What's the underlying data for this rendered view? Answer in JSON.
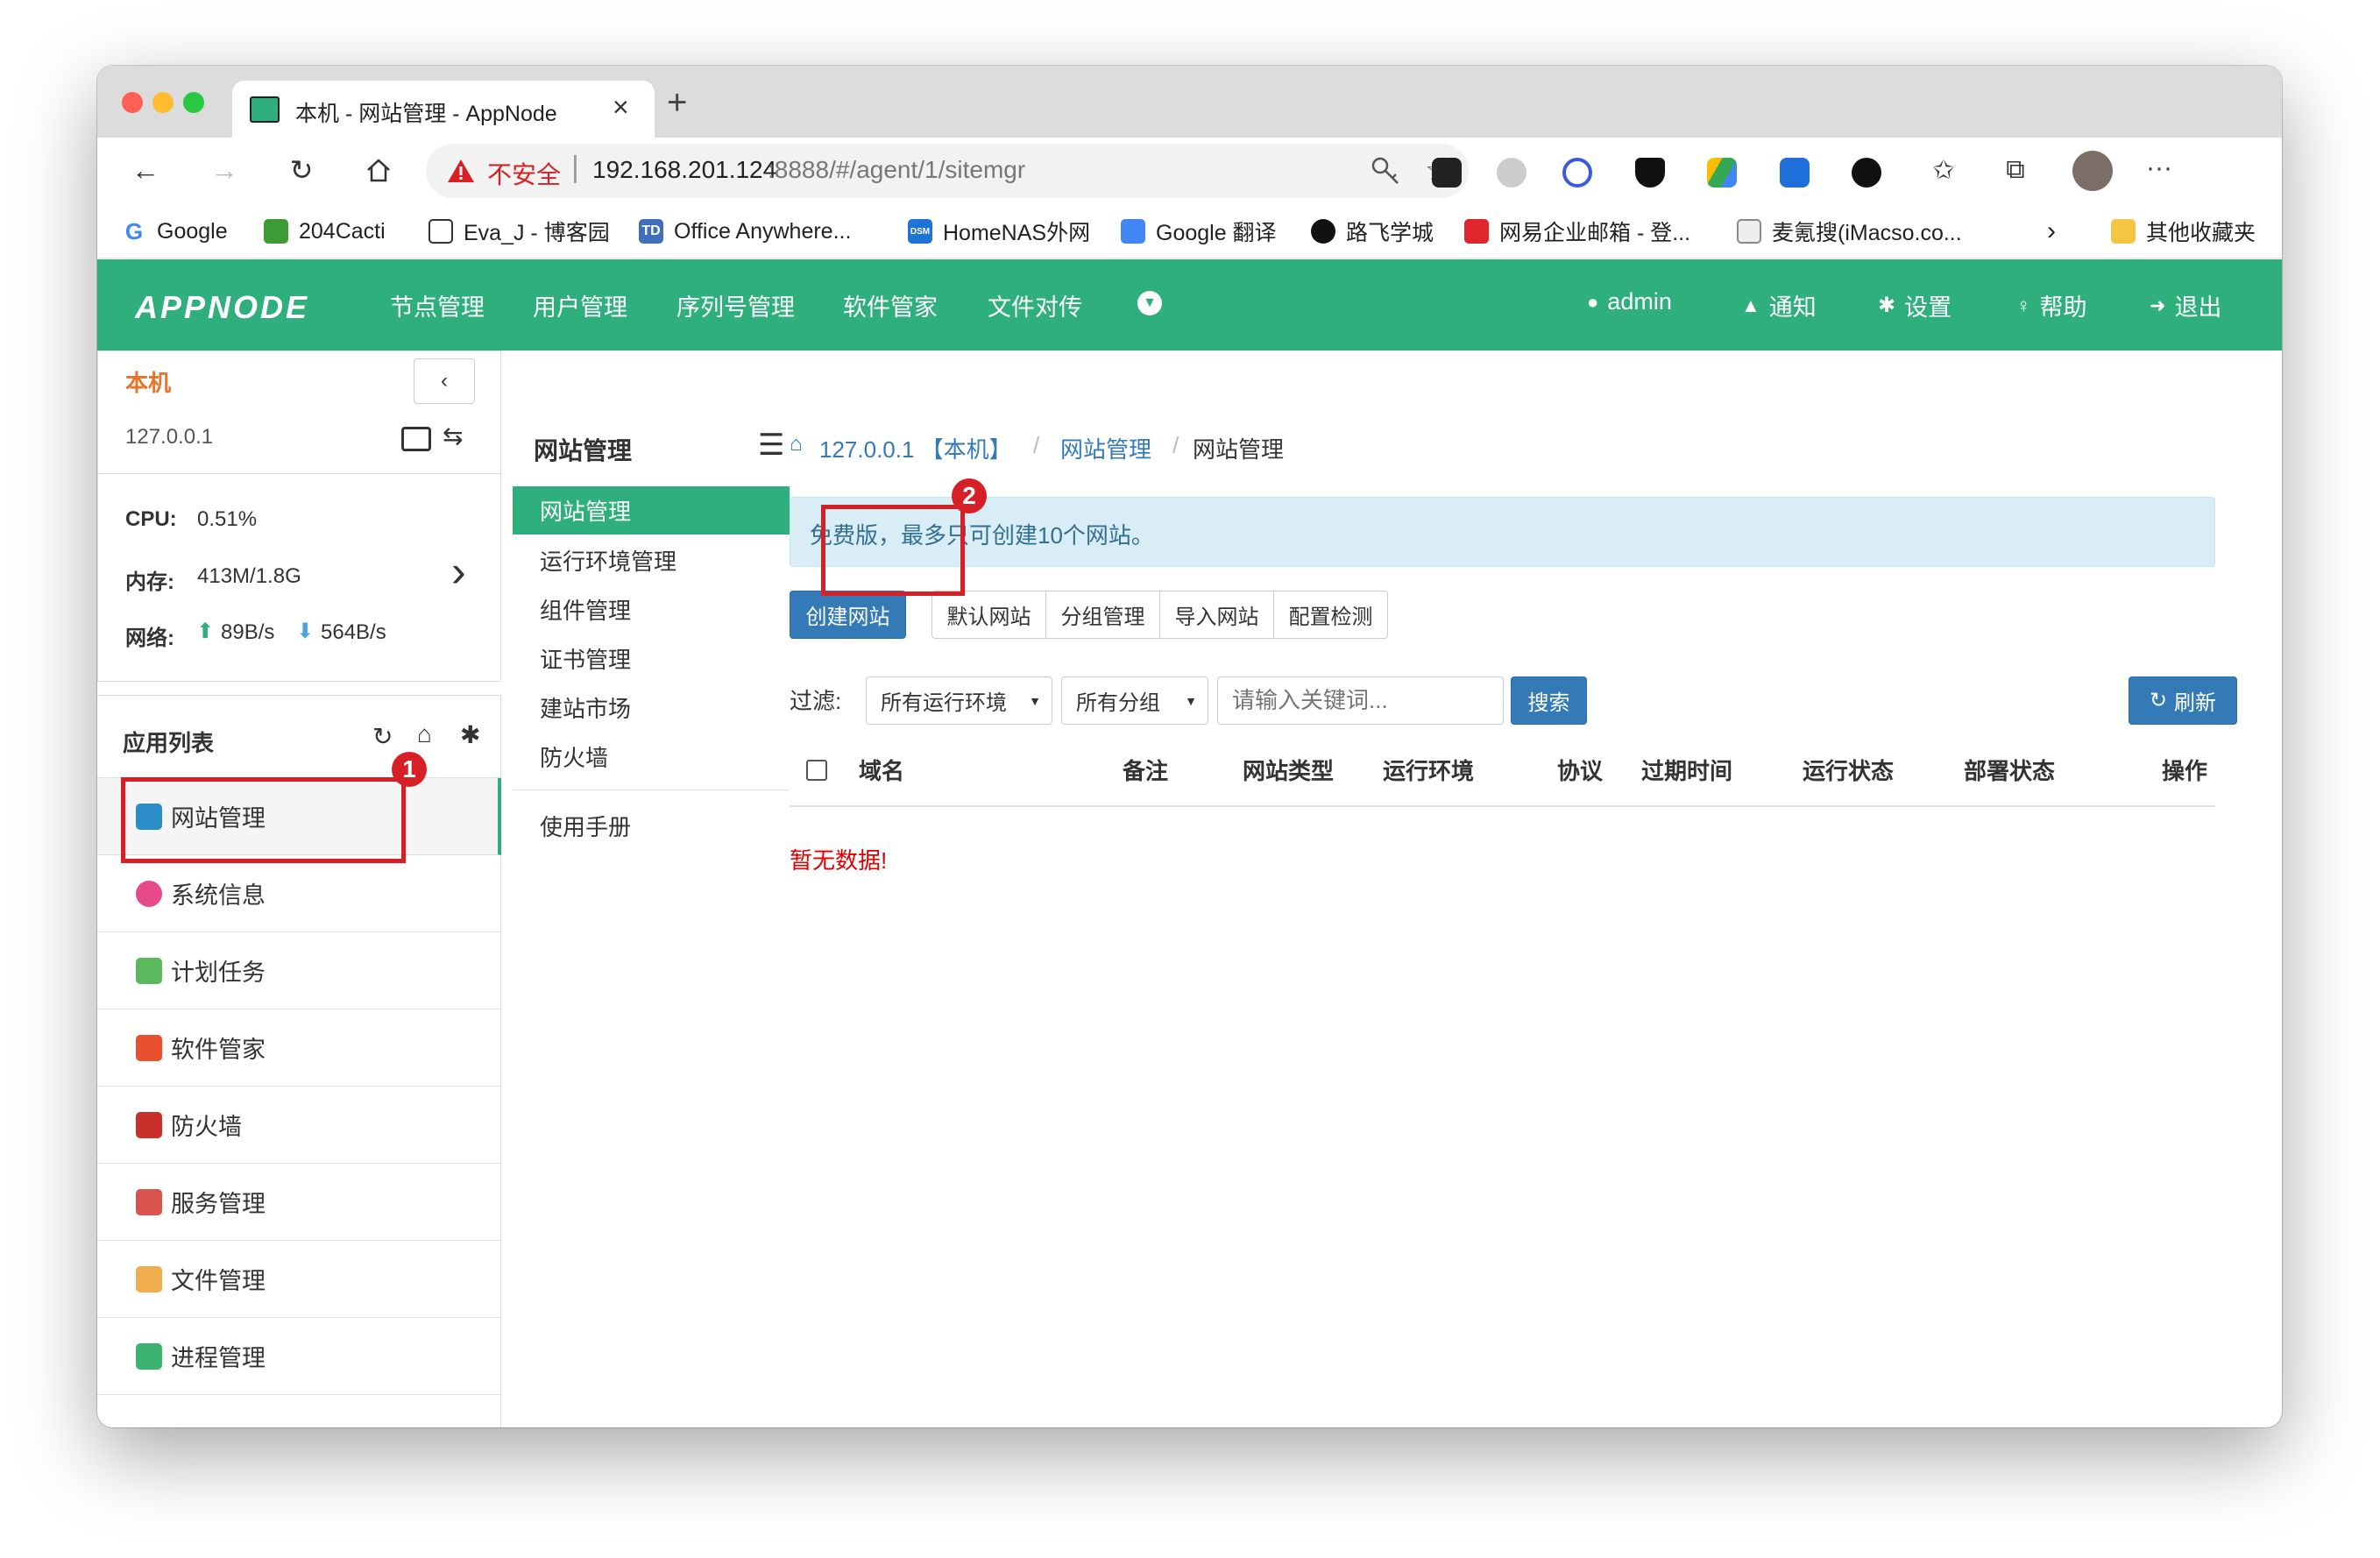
{
  "browser": {
    "tab_title": "本机 - 网站管理 - AppNode",
    "tab_close": "×",
    "new_tab": "+",
    "security_label": "不安全",
    "url_host": "192.168.201.124",
    "url_rest": ":8888/#/agent/1/sitemgr",
    "more": "···",
    "bookmarks": [
      {
        "label": "Google",
        "icon": "google-icon"
      },
      {
        "label": "204Cacti",
        "icon": "cacti-icon"
      },
      {
        "label": "Eva_J - 博客园",
        "icon": "cnblogs-icon"
      },
      {
        "label": "Office Anywhere...",
        "icon": "td-icon"
      },
      {
        "label": "HomeNAS外网",
        "icon": "dsm-icon"
      },
      {
        "label": "Google 翻译",
        "icon": "translate-icon"
      },
      {
        "label": "路飞学城",
        "icon": "luffy-icon"
      },
      {
        "label": "网易企业邮箱 - 登...",
        "icon": "netease-icon"
      },
      {
        "label": "麦氪搜(iMacso.co...",
        "icon": "imacso-icon"
      }
    ],
    "other_bookmarks": "其他收藏夹",
    "bm_td": "TD",
    "bm_dsm": "DSM"
  },
  "appnav": {
    "logo": "APPNODE",
    "items": [
      "节点管理",
      "用户管理",
      "序列号管理",
      "软件管家",
      "文件对传"
    ],
    "user": "admin",
    "notify": "通知",
    "settings": "设置",
    "help": "帮助",
    "logout": "退出"
  },
  "node": {
    "name": "本机",
    "ip": "127.0.0.1",
    "cpu_label": "CPU:",
    "cpu_value": "0.51%",
    "mem_label": "内存:",
    "mem_value": "413M/1.8G",
    "net_label": "网络:",
    "net_up": "89B/s",
    "net_down": "564B/s"
  },
  "applist": {
    "title": "应用列表",
    "items": [
      "网站管理",
      "系统信息",
      "计划任务",
      "软件管家",
      "防火墙",
      "服务管理",
      "文件管理",
      "进程管理"
    ]
  },
  "sitemenu": {
    "title": "网站管理",
    "items": [
      "网站管理",
      "运行环境管理",
      "组件管理",
      "证书管理",
      "建站市场",
      "防火墙"
    ],
    "manual": "使用手册"
  },
  "breadcrumb": {
    "node": "127.0.0.1 【本机】",
    "sep": "/",
    "section": "网站管理",
    "current": "网站管理"
  },
  "notice": "免费版，最多只可创建10个网站。",
  "actions": {
    "create": "创建网站",
    "group": [
      "默认网站",
      "分组管理",
      "导入网站",
      "配置检测"
    ]
  },
  "filter": {
    "label": "过滤:",
    "env_select": "所有运行环境",
    "group_select": "所有分组",
    "search_placeholder": "请输入关键词...",
    "search_button": "搜索",
    "refresh": "刷新"
  },
  "table": {
    "headers": [
      "域名",
      "备注",
      "网站类型",
      "运行环境",
      "协议",
      "过期时间",
      "运行状态",
      "部署状态",
      "操作"
    ],
    "empty": "暂无数据!"
  },
  "annotations": {
    "badge1": "1",
    "badge2": "2"
  },
  "colors": {
    "brand": "#2eaf7d",
    "primary": "#337ab7",
    "annotation": "#d71f26",
    "danger": "#e00000"
  }
}
